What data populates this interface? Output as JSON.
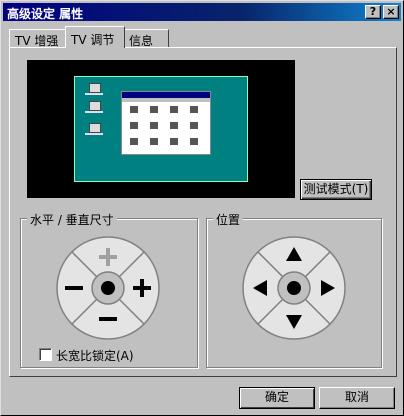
{
  "window": {
    "title": "高级设定 属性",
    "help_button": "?",
    "close_button": "×"
  },
  "tabs": [
    {
      "label": "TV 增强",
      "active": false
    },
    {
      "label": "TV 调节",
      "active": true
    },
    {
      "label": "信息",
      "active": false
    }
  ],
  "preview": {
    "test_mode_button": "测试模式(T)"
  },
  "size_group": {
    "label": "水平 / 垂直尺寸",
    "aspect_lock_label": "长宽比锁定(A)",
    "aspect_lock_checked": false
  },
  "position_group": {
    "label": "位置"
  },
  "buttons": {
    "ok": "确定",
    "cancel": "取消"
  },
  "colors": {
    "titlebar": "#000080",
    "desktop": "#008080",
    "face": "#c0c0c0"
  }
}
